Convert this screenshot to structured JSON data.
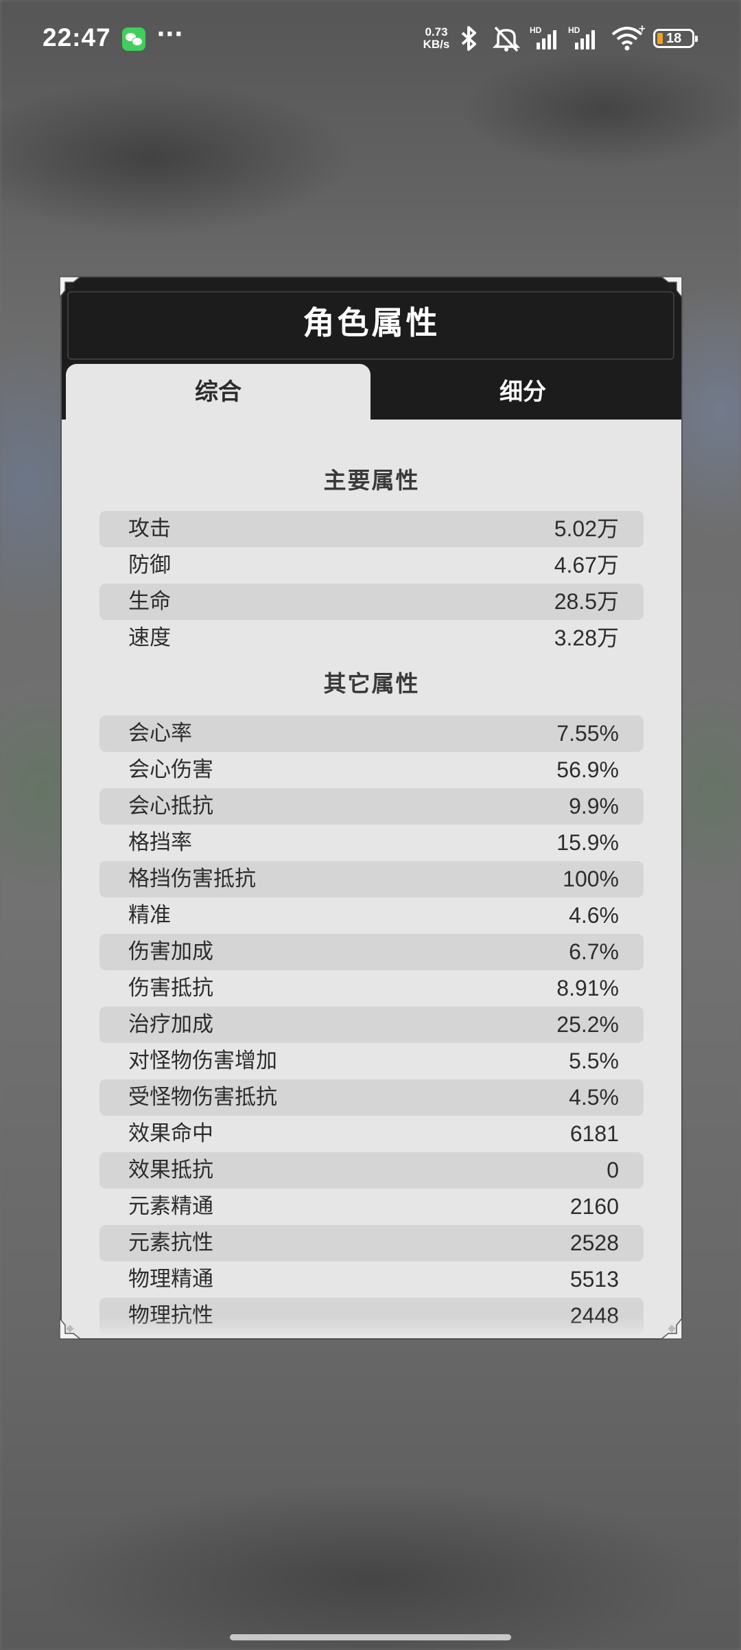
{
  "status_bar": {
    "time": "22:47",
    "app_icon": "wechat-icon",
    "more": "···",
    "net_speed_value": "0.73",
    "net_speed_unit": "KB/s",
    "icons": [
      "bluetooth-icon",
      "mute-icon",
      "signal-hd-icon",
      "signal-hd-icon",
      "wifi-icon"
    ],
    "battery": "18"
  },
  "panel": {
    "title": "角色属性",
    "tabs": [
      {
        "label": "综合",
        "active": true
      },
      {
        "label": "细分",
        "active": false
      }
    ],
    "main_section": {
      "title": "主要属性",
      "rows": [
        {
          "label": "攻击",
          "value": "5.02万"
        },
        {
          "label": "防御",
          "value": "4.67万"
        },
        {
          "label": "生命",
          "value": "28.5万"
        },
        {
          "label": "速度",
          "value": "3.28万"
        }
      ]
    },
    "other_section": {
      "title": "其它属性",
      "rows": [
        {
          "label": "会心率",
          "value": "7.55%"
        },
        {
          "label": "会心伤害",
          "value": "56.9%"
        },
        {
          "label": "会心抵抗",
          "value": "9.9%"
        },
        {
          "label": "格挡率",
          "value": "15.9%"
        },
        {
          "label": "格挡伤害抵抗",
          "value": "100%"
        },
        {
          "label": "精准",
          "value": "4.6%"
        },
        {
          "label": "伤害加成",
          "value": "6.7%"
        },
        {
          "label": "伤害抵抗",
          "value": "8.91%"
        },
        {
          "label": "治疗加成",
          "value": "25.2%"
        },
        {
          "label": "对怪物伤害增加",
          "value": "5.5%"
        },
        {
          "label": "受怪物伤害抵抗",
          "value": "4.5%"
        },
        {
          "label": "效果命中",
          "value": "6181"
        },
        {
          "label": "效果抵抗",
          "value": "0"
        },
        {
          "label": "元素精通",
          "value": "2160"
        },
        {
          "label": "元素抗性",
          "value": "2528"
        },
        {
          "label": "物理精通",
          "value": "5513"
        },
        {
          "label": "物理抗性",
          "value": "2448"
        }
      ]
    }
  }
}
